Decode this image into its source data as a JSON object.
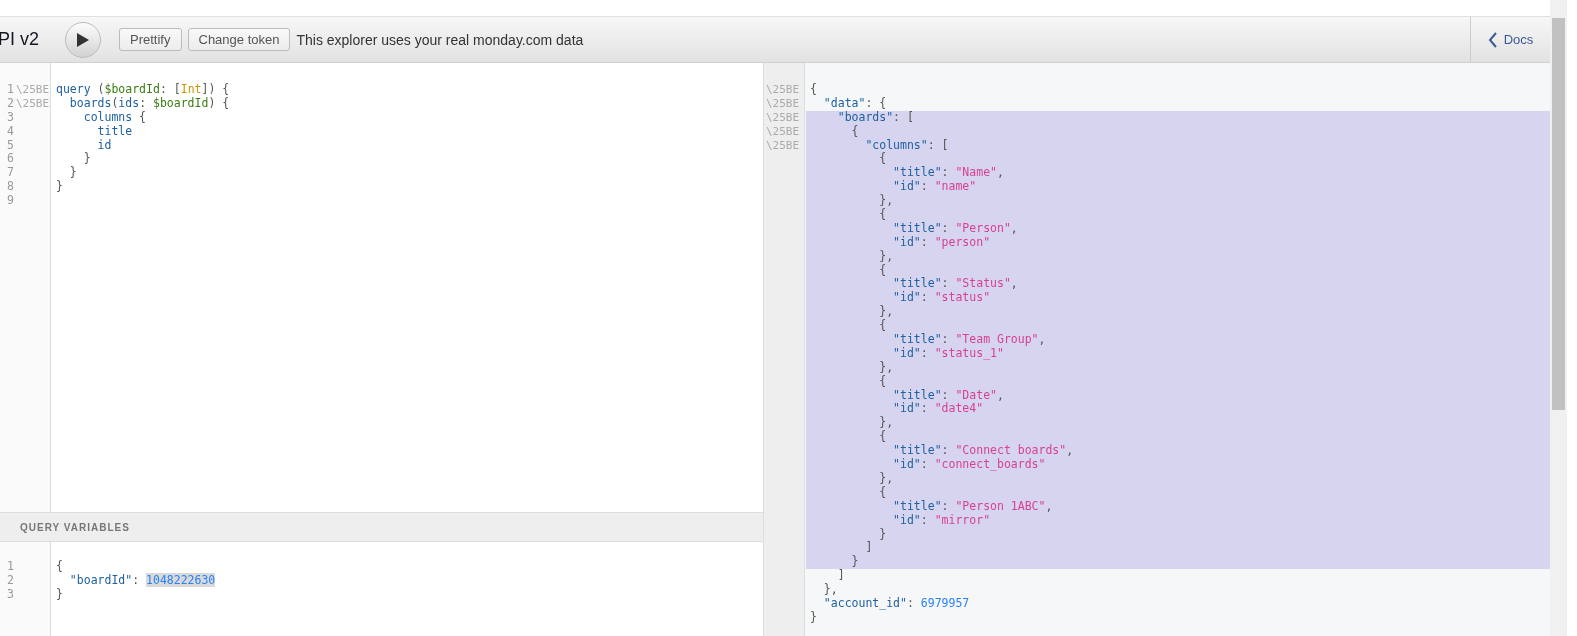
{
  "title": "PI v2",
  "toolbar": {
    "buttons": [
      {
        "label": "Prettify"
      },
      {
        "label": "Change token"
      }
    ],
    "notice": "This explorer uses your real monday.com data",
    "docs": "Docs"
  },
  "query_editor": {
    "lines": [
      {
        "number": "1",
        "fold": "\\25BE",
        "text": "query ($boardId: [Int]) {"
      },
      {
        "number": "2",
        "fold": "\\25BE",
        "text": "  boards(ids: $boardId) {"
      },
      {
        "number": "3",
        "text": "    columns {"
      },
      {
        "number": "4",
        "text": "      title"
      },
      {
        "number": "5",
        "text": "      id"
      },
      {
        "number": "6",
        "text": "    }"
      },
      {
        "number": "7",
        "text": "  }"
      },
      {
        "number": "8",
        "text": "}"
      },
      {
        "number": "9"
      }
    ]
  },
  "variables": {
    "header": "QUERY VARIABLES",
    "lines": [
      {
        "number": "1",
        "text": "{"
      },
      {
        "number": "2",
        "text": "  \"boardId\": ",
        "selection": "1048222630"
      },
      {
        "number": "3",
        "text": "}"
      }
    ]
  },
  "result": {
    "lines": [
      {
        "fold": "\\25BE",
        "text": "{",
        "highlighted": false
      },
      {
        "fold": "\\25BE",
        "text": "  \"data\": {",
        "highlighted": false
      },
      {
        "fold": "\\25BE",
        "text": "    \"boards\": [",
        "highlighted": true
      },
      {
        "fold": "\\25BE",
        "text": "      {",
        "highlighted": true
      },
      {
        "fold": "\\25BE",
        "text": "        \"columns\": [",
        "highlighted": true
      },
      {
        "text": "          {",
        "highlighted": true
      },
      {
        "text": "            \"title\": \"Name\",",
        "highlighted": true
      },
      {
        "text": "            \"id\": \"name\"",
        "highlighted": true
      },
      {
        "text": "          },",
        "highlighted": true
      },
      {
        "text": "          {",
        "highlighted": true
      },
      {
        "text": "            \"title\": \"Person\",",
        "highlighted": true
      },
      {
        "text": "            \"id\": \"person\"",
        "highlighted": true
      },
      {
        "text": "          },",
        "highlighted": true
      },
      {
        "text": "          {",
        "highlighted": true
      },
      {
        "text": "            \"title\": \"Status\",",
        "highlighted": true
      },
      {
        "text": "            \"id\": \"status\"",
        "highlighted": true
      },
      {
        "text": "          },",
        "highlighted": true
      },
      {
        "text": "          {",
        "highlighted": true
      },
      {
        "text": "            \"title\": \"Team Group\",",
        "highlighted": true
      },
      {
        "text": "            \"id\": \"status_1\"",
        "highlighted": true
      },
      {
        "text": "          },",
        "highlighted": true
      },
      {
        "text": "          {",
        "highlighted": true
      },
      {
        "text": "            \"title\": \"Date\",",
        "highlighted": true
      },
      {
        "text": "            \"id\": \"date4\"",
        "highlighted": true
      },
      {
        "text": "          },",
        "highlighted": true
      },
      {
        "text": "          {",
        "highlighted": true
      },
      {
        "text": "            \"title\": \"Connect boards\",",
        "highlighted": true
      },
      {
        "text": "            \"id\": \"connect_boards\"",
        "highlighted": true
      },
      {
        "text": "          },",
        "highlighted": true
      },
      {
        "text": "          {",
        "highlighted": true
      },
      {
        "text": "            \"title\": \"Person 1ABC\",",
        "highlighted": true
      },
      {
        "text": "            \"id\": \"mirror\"",
        "highlighted": true
      },
      {
        "text": "          }",
        "highlighted": true
      },
      {
        "text": "        ]",
        "highlighted": true
      },
      {
        "text": "      }",
        "highlighted": true
      },
      {
        "text": "    ]",
        "highlighted": false
      },
      {
        "text": "  },",
        "highlighted": false
      },
      {
        "text": "  \"account_id\": 6979957",
        "highlighted": false
      },
      {
        "text": "}",
        "highlighted": false
      }
    ]
  }
}
